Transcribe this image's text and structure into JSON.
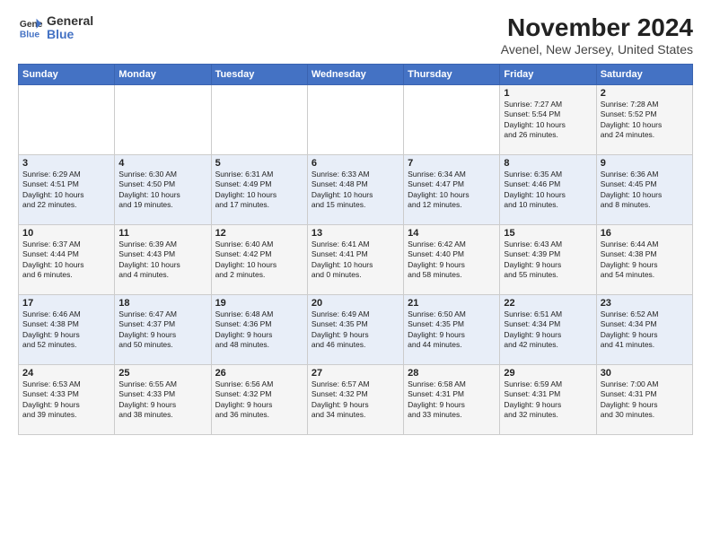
{
  "logo": {
    "line1": "General",
    "line2": "Blue"
  },
  "title": "November 2024",
  "subtitle": "Avenel, New Jersey, United States",
  "days_of_week": [
    "Sunday",
    "Monday",
    "Tuesday",
    "Wednesday",
    "Thursday",
    "Friday",
    "Saturday"
  ],
  "weeks": [
    [
      {
        "day": "",
        "info": ""
      },
      {
        "day": "",
        "info": ""
      },
      {
        "day": "",
        "info": ""
      },
      {
        "day": "",
        "info": ""
      },
      {
        "day": "",
        "info": ""
      },
      {
        "day": "1",
        "info": "Sunrise: 7:27 AM\nSunset: 5:54 PM\nDaylight: 10 hours\nand 26 minutes."
      },
      {
        "day": "2",
        "info": "Sunrise: 7:28 AM\nSunset: 5:52 PM\nDaylight: 10 hours\nand 24 minutes."
      }
    ],
    [
      {
        "day": "3",
        "info": "Sunrise: 6:29 AM\nSunset: 4:51 PM\nDaylight: 10 hours\nand 22 minutes."
      },
      {
        "day": "4",
        "info": "Sunrise: 6:30 AM\nSunset: 4:50 PM\nDaylight: 10 hours\nand 19 minutes."
      },
      {
        "day": "5",
        "info": "Sunrise: 6:31 AM\nSunset: 4:49 PM\nDaylight: 10 hours\nand 17 minutes."
      },
      {
        "day": "6",
        "info": "Sunrise: 6:33 AM\nSunset: 4:48 PM\nDaylight: 10 hours\nand 15 minutes."
      },
      {
        "day": "7",
        "info": "Sunrise: 6:34 AM\nSunset: 4:47 PM\nDaylight: 10 hours\nand 12 minutes."
      },
      {
        "day": "8",
        "info": "Sunrise: 6:35 AM\nSunset: 4:46 PM\nDaylight: 10 hours\nand 10 minutes."
      },
      {
        "day": "9",
        "info": "Sunrise: 6:36 AM\nSunset: 4:45 PM\nDaylight: 10 hours\nand 8 minutes."
      }
    ],
    [
      {
        "day": "10",
        "info": "Sunrise: 6:37 AM\nSunset: 4:44 PM\nDaylight: 10 hours\nand 6 minutes."
      },
      {
        "day": "11",
        "info": "Sunrise: 6:39 AM\nSunset: 4:43 PM\nDaylight: 10 hours\nand 4 minutes."
      },
      {
        "day": "12",
        "info": "Sunrise: 6:40 AM\nSunset: 4:42 PM\nDaylight: 10 hours\nand 2 minutes."
      },
      {
        "day": "13",
        "info": "Sunrise: 6:41 AM\nSunset: 4:41 PM\nDaylight: 10 hours\nand 0 minutes."
      },
      {
        "day": "14",
        "info": "Sunrise: 6:42 AM\nSunset: 4:40 PM\nDaylight: 9 hours\nand 58 minutes."
      },
      {
        "day": "15",
        "info": "Sunrise: 6:43 AM\nSunset: 4:39 PM\nDaylight: 9 hours\nand 55 minutes."
      },
      {
        "day": "16",
        "info": "Sunrise: 6:44 AM\nSunset: 4:38 PM\nDaylight: 9 hours\nand 54 minutes."
      }
    ],
    [
      {
        "day": "17",
        "info": "Sunrise: 6:46 AM\nSunset: 4:38 PM\nDaylight: 9 hours\nand 52 minutes."
      },
      {
        "day": "18",
        "info": "Sunrise: 6:47 AM\nSunset: 4:37 PM\nDaylight: 9 hours\nand 50 minutes."
      },
      {
        "day": "19",
        "info": "Sunrise: 6:48 AM\nSunset: 4:36 PM\nDaylight: 9 hours\nand 48 minutes."
      },
      {
        "day": "20",
        "info": "Sunrise: 6:49 AM\nSunset: 4:35 PM\nDaylight: 9 hours\nand 46 minutes."
      },
      {
        "day": "21",
        "info": "Sunrise: 6:50 AM\nSunset: 4:35 PM\nDaylight: 9 hours\nand 44 minutes."
      },
      {
        "day": "22",
        "info": "Sunrise: 6:51 AM\nSunset: 4:34 PM\nDaylight: 9 hours\nand 42 minutes."
      },
      {
        "day": "23",
        "info": "Sunrise: 6:52 AM\nSunset: 4:34 PM\nDaylight: 9 hours\nand 41 minutes."
      }
    ],
    [
      {
        "day": "24",
        "info": "Sunrise: 6:53 AM\nSunset: 4:33 PM\nDaylight: 9 hours\nand 39 minutes."
      },
      {
        "day": "25",
        "info": "Sunrise: 6:55 AM\nSunset: 4:33 PM\nDaylight: 9 hours\nand 38 minutes."
      },
      {
        "day": "26",
        "info": "Sunrise: 6:56 AM\nSunset: 4:32 PM\nDaylight: 9 hours\nand 36 minutes."
      },
      {
        "day": "27",
        "info": "Sunrise: 6:57 AM\nSunset: 4:32 PM\nDaylight: 9 hours\nand 34 minutes."
      },
      {
        "day": "28",
        "info": "Sunrise: 6:58 AM\nSunset: 4:31 PM\nDaylight: 9 hours\nand 33 minutes."
      },
      {
        "day": "29",
        "info": "Sunrise: 6:59 AM\nSunset: 4:31 PM\nDaylight: 9 hours\nand 32 minutes."
      },
      {
        "day": "30",
        "info": "Sunrise: 7:00 AM\nSunset: 4:31 PM\nDaylight: 9 hours\nand 30 minutes."
      }
    ]
  ]
}
